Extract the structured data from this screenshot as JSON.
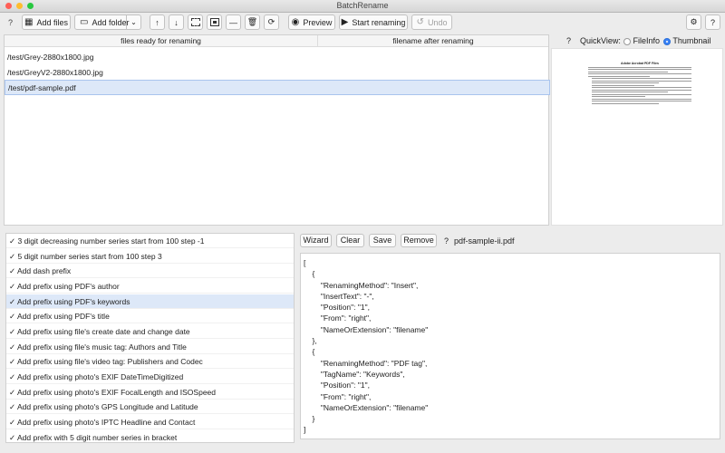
{
  "window": {
    "title": "BatchRename"
  },
  "toolbar": {
    "help": "?",
    "add_files": "Add files",
    "add_folder": "Add folder",
    "preview": "Preview",
    "start_renaming": "Start renaming",
    "undo": "Undo",
    "help_right": "?"
  },
  "files_table": {
    "col1": "files ready for renaming",
    "col2": "filename after renaming",
    "rows": [
      {
        "name": "/test/Grey-2880x1800.jpg",
        "renamed": ""
      },
      {
        "name": "/test/GreyV2-2880x1800.jpg",
        "renamed": ""
      },
      {
        "name": "/test/pdf-sample.pdf",
        "renamed": ""
      }
    ]
  },
  "quickview": {
    "help": "?",
    "label": "QuickView:",
    "opt_fileinfo": "FileInfo",
    "opt_thumbnail": "Thumbnail",
    "selected": "Thumbnail",
    "thumb_title": "Adobe Acrobat PDF Files"
  },
  "rules": [
    "✓ 3 digit decreasing number series start from 100 step -1",
    "✓ 5 digit number series start from 100 step 3",
    "✓ Add dash prefix",
    "✓ Add prefix using PDF's author",
    "✓ Add prefix using PDF's keywords",
    "✓ Add prefix using PDF's title",
    "✓ Add prefix using file's create date and change date",
    "✓ Add prefix using file's music tag: Authors and Title",
    "✓ Add prefix using file's video tag: Publishers and Codec",
    "✓ Add prefix using photo's EXIF DateTimeDigitized",
    "✓ Add prefix using photo's EXIF FocalLength and ISOSpeed",
    "✓ Add prefix using photo's GPS Longitude and Latitude",
    "✓ Add prefix using photo's IPTC Headline and Contact",
    "✓ Add prefix with 5 digit number series in bracket"
  ],
  "editor": {
    "wizard": "Wizard",
    "clear": "Clear",
    "save": "Save",
    "remove": "Remove",
    "help": "?",
    "filename": "pdf-sample-ii.pdf",
    "json_text": "[\n    {\n        \"RenamingMethod\": \"Insert\",\n        \"InsertText\": \"-\",\n        \"Position\": \"1\",\n        \"From\": \"right\",\n        \"NameOrExtension\": \"filename\"\n    },\n    {\n        \"RenamingMethod\": \"PDF tag\",\n        \"TagName\": \"Keywords\",\n        \"Position\": \"1\",\n        \"From\": \"right\",\n        \"NameOrExtension\": \"filename\"\n    }\n]"
  },
  "colors": {
    "selection": "#dde8f8",
    "accent": "#3b82f6"
  }
}
